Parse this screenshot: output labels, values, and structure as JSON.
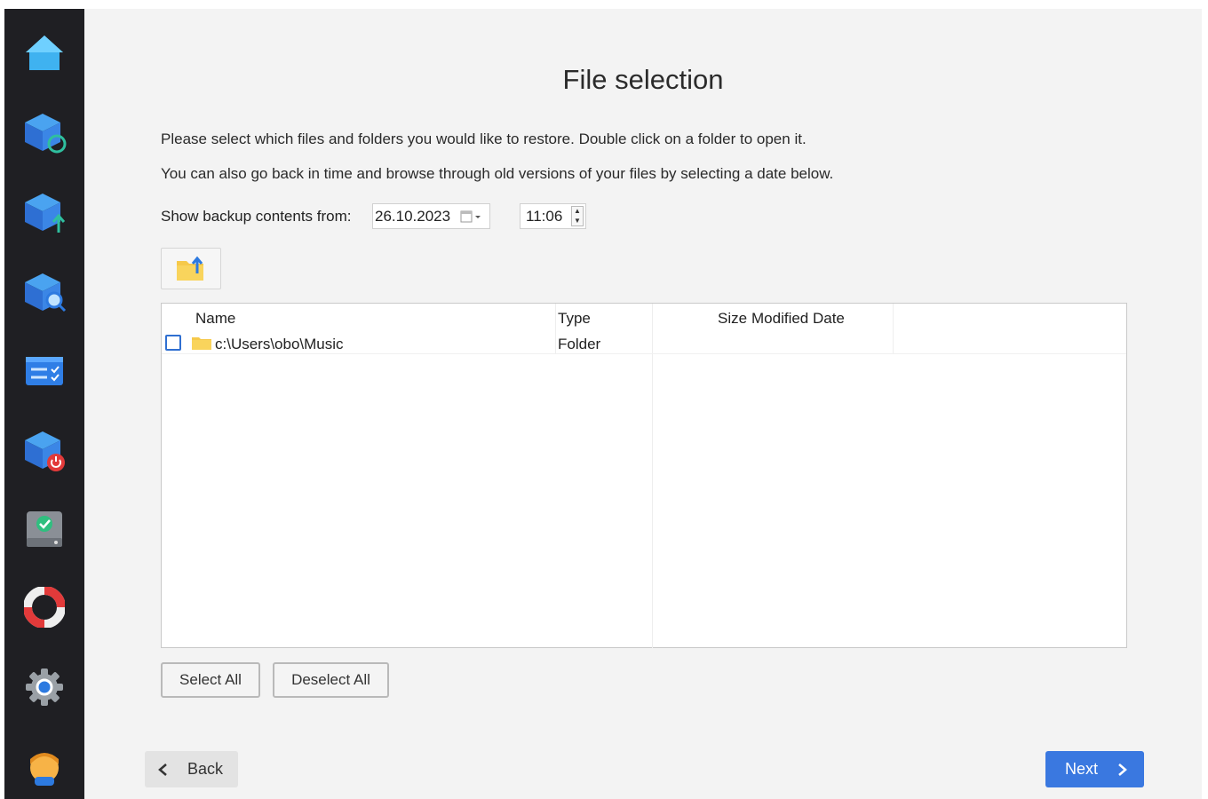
{
  "sidebar": {
    "items": [
      {
        "icon": "home-icon"
      },
      {
        "icon": "backup-refresh-icon"
      },
      {
        "icon": "backup-upload-icon"
      },
      {
        "icon": "backup-search-icon"
      },
      {
        "icon": "task-list-icon"
      },
      {
        "icon": "backup-power-icon"
      },
      {
        "icon": "disk-check-icon"
      },
      {
        "icon": "help-lifebuoy-icon"
      },
      {
        "icon": "settings-gear-icon"
      },
      {
        "icon": "user-avatar-icon"
      }
    ]
  },
  "main": {
    "title": "File selection",
    "description_line1": "Please select which files and folders you would like to restore. Double click on a folder to open it.",
    "description_line2": "You can also go back in time and browse through old versions of your files by selecting a date below.",
    "show_label": "Show backup contents from:",
    "date_value": "26.10.2023",
    "time_value": "11:06"
  },
  "filelist": {
    "columns": [
      "Name",
      "Type",
      "Size",
      "Modified Date"
    ],
    "rows": [
      {
        "name": "c:\\Users\\obo\\Music",
        "type": "Folder",
        "size": "",
        "modified": "",
        "checked": false
      }
    ]
  },
  "buttons": {
    "select_all": "Select All",
    "deselect_all": "Deselect All",
    "back": "Back",
    "next": "Next"
  },
  "colors": {
    "sidebar_bg": "#1f1f23",
    "accent": "#3a78e0",
    "main_bg": "#f3f3f3"
  }
}
